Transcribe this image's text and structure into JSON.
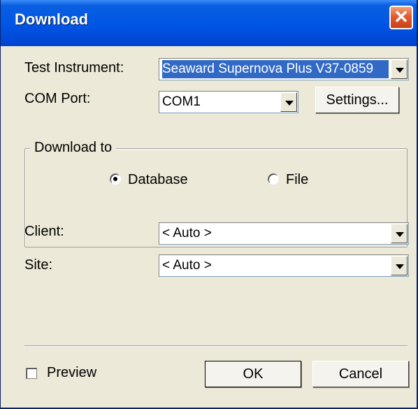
{
  "window": {
    "title": "Download",
    "close_glyph": "✕"
  },
  "test_instrument": {
    "label": "Test Instrument:",
    "value": "Seaward Supernova Plus V37-0859"
  },
  "com_port": {
    "label": "COM Port:",
    "value": "COM1",
    "settings_label": "Settings..."
  },
  "download_to": {
    "title": "Download to",
    "options": [
      {
        "label": "Database",
        "selected": true
      },
      {
        "label": "File",
        "selected": false
      }
    ]
  },
  "client": {
    "label": "Client:",
    "value": "< Auto >"
  },
  "site": {
    "label": "Site:",
    "value": "< Auto >"
  },
  "preview": {
    "label": "Preview",
    "checked": false
  },
  "buttons": {
    "ok": "OK",
    "cancel": "Cancel"
  },
  "colors": {
    "title_bar": "#0055e5",
    "close_button": "#e25b2c",
    "dialog_face": "#ece9d8",
    "selection": "#316ac5"
  }
}
